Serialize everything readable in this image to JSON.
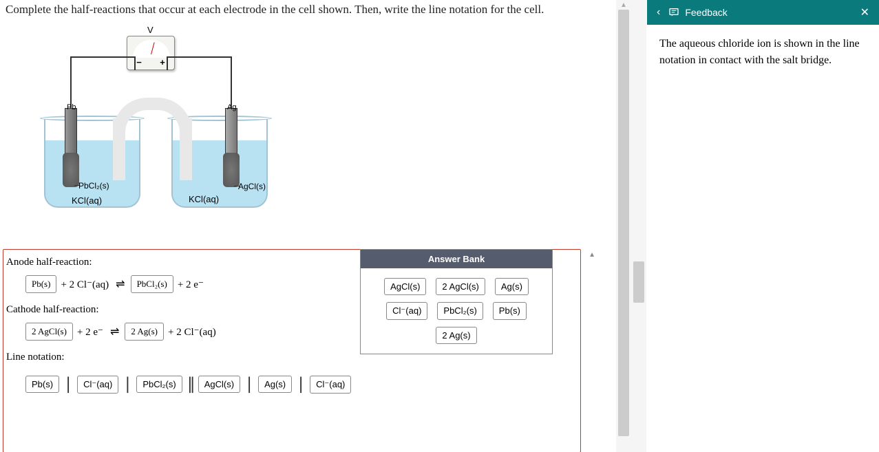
{
  "question": "Complete the half-reactions that occur at each electrode in the cell shown. Then, write the line notation for the cell.",
  "diagram": {
    "voltmeter_label": "V",
    "terminal_neg": "−",
    "terminal_pos": "+",
    "electrode_left": "Pb",
    "electrode_right": "Ag",
    "coating_left": "PbCl₂(s)",
    "coating_right": "AgCl(s)",
    "solution_left": "KCl(aq)",
    "solution_right": "KCl(aq)"
  },
  "sections": {
    "anode_label": "Anode half-reaction:",
    "cathode_label": "Cathode half-reaction:",
    "line_label": "Line notation:"
  },
  "anode": {
    "slot1": "Pb(s)",
    "text1": "+ 2 Cl⁻(aq)",
    "arrow": "⇌",
    "slot2": "PbCl₂(s)",
    "text2": "+ 2 e⁻"
  },
  "cathode": {
    "slot1": "2 AgCl(s)",
    "text1": "+ 2 e⁻",
    "arrow": "⇌",
    "slot2": "2 Ag(s)",
    "text2": "+ 2 Cl⁻(aq)"
  },
  "line_notation": {
    "t1": "Pb(s)",
    "t2": "Cl⁻(aq)",
    "t3": "PbCl₂(s)",
    "t4": "AgCl(s)",
    "t5": "Ag(s)",
    "t6": "Cl⁻(aq)"
  },
  "bank": {
    "header": "Answer Bank",
    "items": [
      "AgCl(s)",
      "2 AgCl(s)",
      "Ag(s)",
      "Cl⁻(aq)",
      "PbCl₂(s)",
      "Pb(s)",
      "2 Ag(s)"
    ]
  },
  "feedback": {
    "title": "Feedback",
    "body": "The aqueous chloride ion is shown in the line notation in contact with the salt bridge."
  }
}
